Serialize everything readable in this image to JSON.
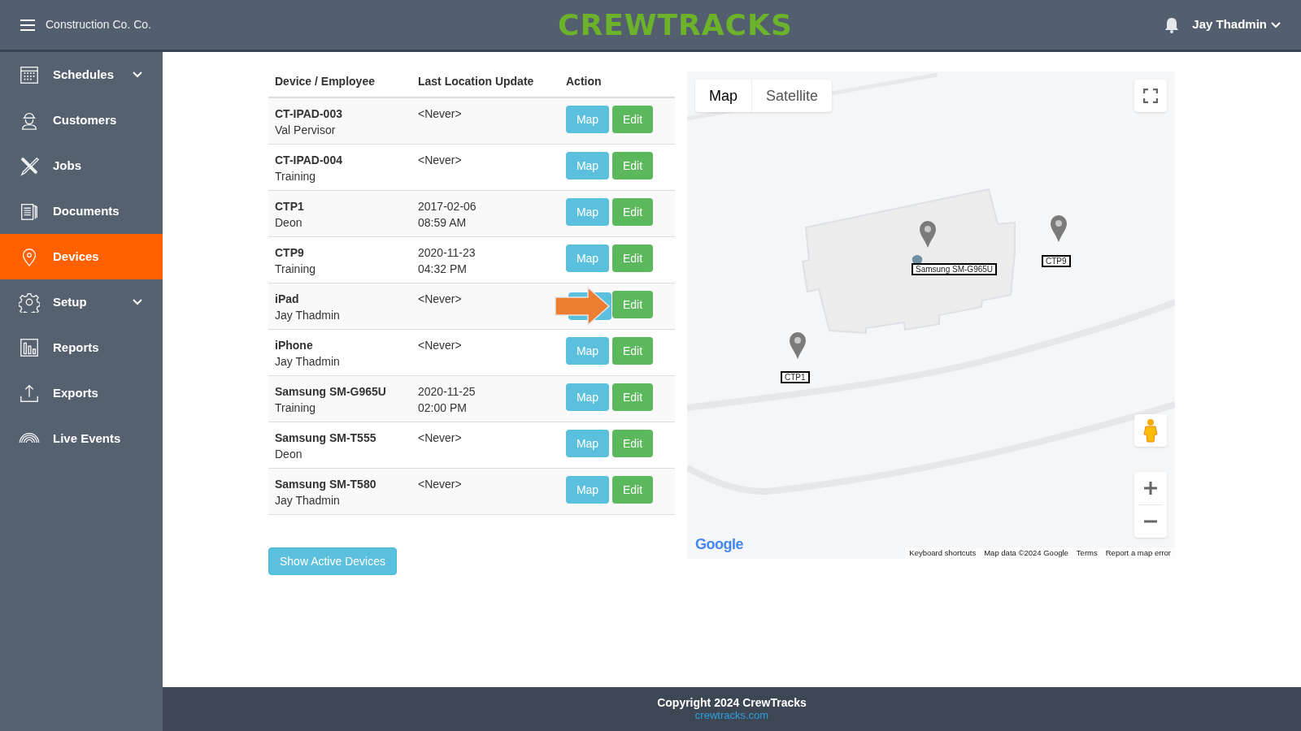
{
  "header": {
    "company": "Construction Co. Co.",
    "logo": "CREWTRACKS",
    "user": "Jay Thadmin"
  },
  "sidebar": {
    "items": [
      {
        "label": "Schedules",
        "selected": false,
        "expandable": true
      },
      {
        "label": "Customers",
        "selected": false,
        "expandable": false
      },
      {
        "label": "Jobs",
        "selected": false,
        "expandable": false
      },
      {
        "label": "Documents",
        "selected": false,
        "expandable": false
      },
      {
        "label": "Devices",
        "selected": true,
        "expandable": false
      },
      {
        "label": "Setup",
        "selected": false,
        "expandable": true
      },
      {
        "label": "Reports",
        "selected": false,
        "expandable": false
      },
      {
        "label": "Exports",
        "selected": false,
        "expandable": false
      },
      {
        "label": "Live Events",
        "selected": false,
        "expandable": false
      }
    ]
  },
  "table": {
    "columns": [
      "Device / Employee",
      "Last Location Update",
      "Action"
    ],
    "rows": [
      {
        "device": "CT-IPAD-003",
        "employee": "Val Pervisor",
        "update": [
          "<Never>"
        ],
        "map_button": "Map",
        "edit_button": "Edit",
        "arrow": false
      },
      {
        "device": "CT-IPAD-004",
        "employee": "Training",
        "update": [
          "<Never>"
        ],
        "map_button": "Map",
        "edit_button": "Edit",
        "arrow": false
      },
      {
        "device": "CTP1",
        "employee": "Deon",
        "update": [
          "2017-02-06",
          "08:59 AM"
        ],
        "map_button": "Map",
        "edit_button": "Edit",
        "arrow": false
      },
      {
        "device": "CTP9",
        "employee": "Training",
        "update": [
          "2020-11-23",
          "04:32 PM"
        ],
        "map_button": "Map",
        "edit_button": "Edit",
        "arrow": false
      },
      {
        "device": "iPad",
        "employee": "Jay Thadmin",
        "update": [
          "<Never>"
        ],
        "edit_button": "Edit",
        "arrow": true
      },
      {
        "device": "iPhone",
        "employee": "Jay Thadmin",
        "update": [
          "<Never>"
        ],
        "map_button": "Map",
        "edit_button": "Edit",
        "arrow": false
      },
      {
        "device": "Samsung SM-G965U",
        "employee": "Training",
        "update": [
          "2020-11-25",
          "02:00 PM"
        ],
        "map_button": "Map",
        "edit_button": "Edit",
        "arrow": false
      },
      {
        "device": "Samsung SM-T555",
        "employee": "Deon",
        "update": [
          "<Never>"
        ],
        "map_button": "Map",
        "edit_button": "Edit",
        "arrow": false
      },
      {
        "device": "Samsung SM-T580",
        "employee": "Jay Thadmin",
        "update": [
          "<Never>"
        ],
        "map_button": "Map",
        "edit_button": "Edit",
        "arrow": false
      }
    ]
  },
  "show_active_button": "Show Active Devices",
  "map": {
    "kind": "picture",
    "tabs": [
      {
        "label": "Map",
        "selected": true
      },
      {
        "label": "Satellite",
        "selected": false
      }
    ],
    "markers": [
      {
        "label": "Samsung SM-G965U"
      },
      {
        "label": "CTP9"
      },
      {
        "label": "CTP1"
      }
    ],
    "logo": "Google",
    "attribution": [
      "Keyboard shortcuts",
      "Map data ©2024 Google",
      "Terms",
      "Report a map error"
    ]
  },
  "footer": {
    "copyright": "Copyright 2024 CrewTracks",
    "link": "crewtracks.com"
  }
}
